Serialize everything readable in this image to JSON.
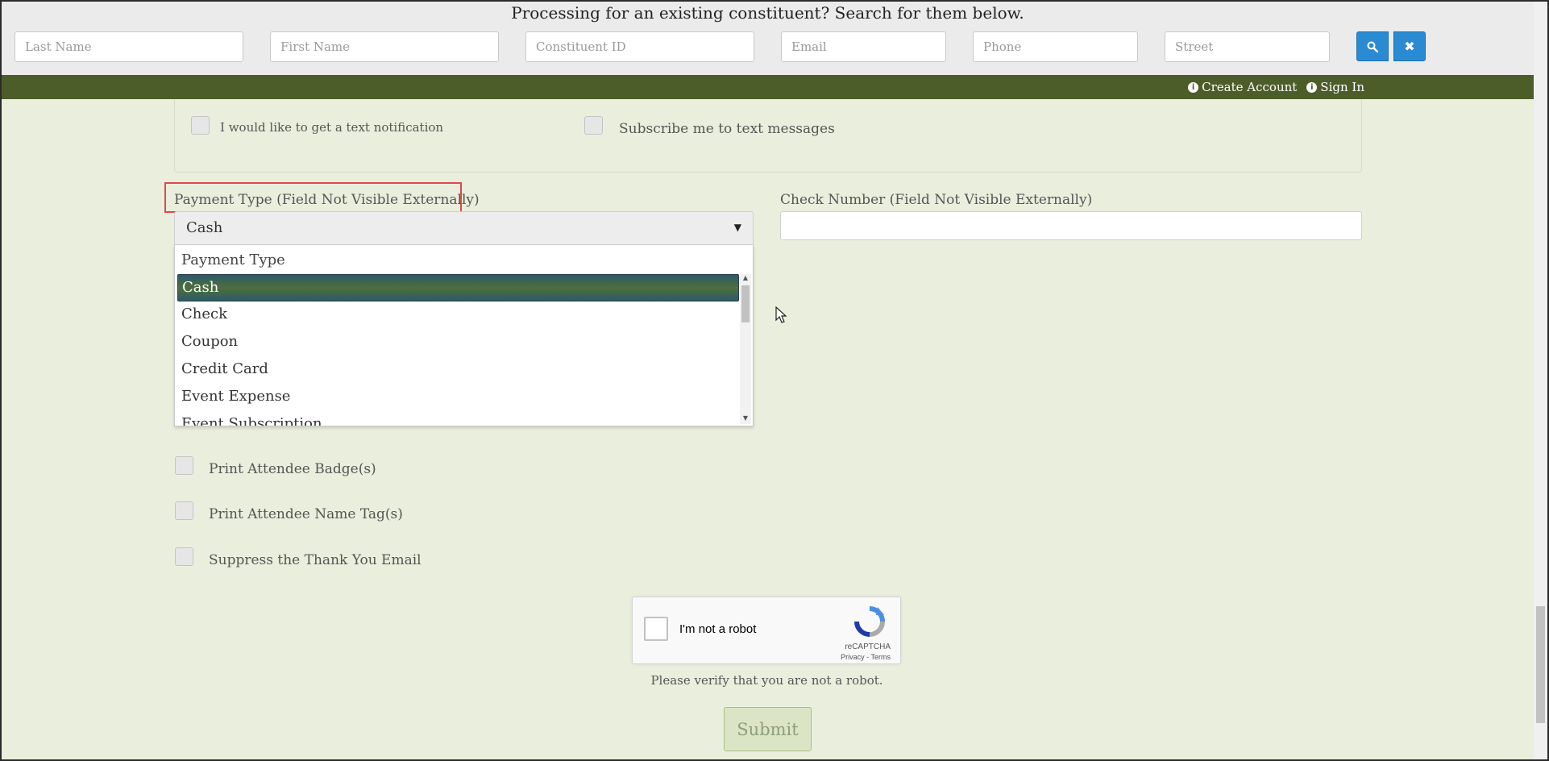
{
  "search": {
    "heading": "Processing for an existing constituent? Search for them below.",
    "fields": {
      "last_name": "Last Name",
      "first_name": "First Name",
      "constituent_id": "Constituent ID",
      "email": "Email",
      "phone": "Phone",
      "street": "Street"
    },
    "search_icon": "search-icon",
    "clear_icon": "close-icon"
  },
  "nav": {
    "create_account": "Create Account",
    "sign_in": "Sign In"
  },
  "notifications": {
    "text_notification": "I would like to get a text notification",
    "subscribe_text": "Subscribe me to text messages"
  },
  "payment": {
    "label": "Payment Type (Field Not Visible Externally)",
    "selected": "Cash",
    "dropdown_header": "Payment Type",
    "options": [
      "Cash",
      "Check",
      "Coupon",
      "Credit Card",
      "Event Expense",
      "Event Subscription"
    ]
  },
  "check_number": {
    "label": "Check Number (Field Not Visible Externally)",
    "value": ""
  },
  "options": {
    "print_badges": "Print Attendee Badge(s)",
    "print_name_tags": "Print Attendee Name Tag(s)",
    "suppress_email": "Suppress the Thank You Email"
  },
  "captcha": {
    "label": "I'm not a robot",
    "brand": "reCAPTCHA",
    "privacy": "Privacy",
    "terms": "Terms",
    "verify": "Please verify that you are not a robot."
  },
  "submit": "Submit",
  "colors": {
    "page_bg": "#e9efdc",
    "nav_green": "#4d5d2a",
    "button_blue": "#2a8ad2",
    "highlight_red": "#e14848"
  }
}
